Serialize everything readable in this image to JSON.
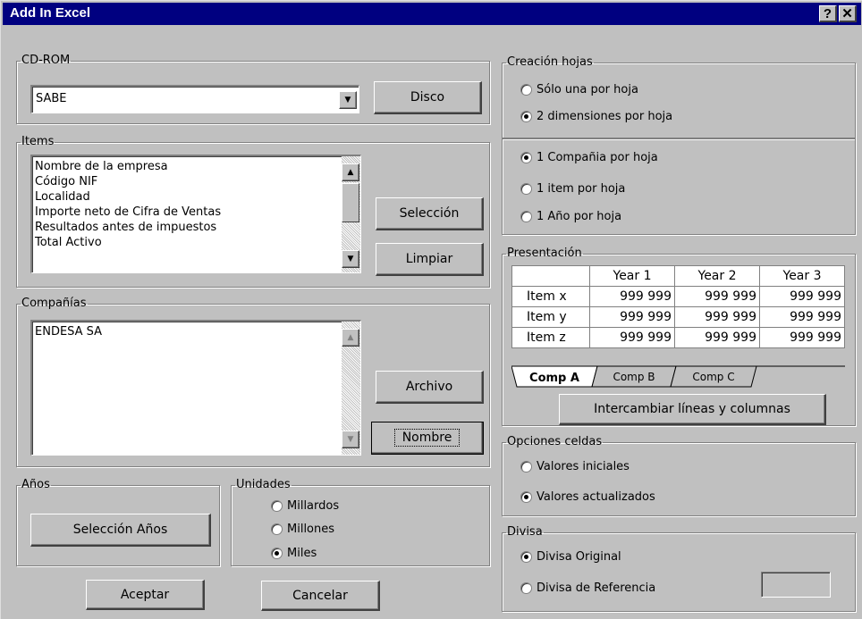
{
  "window": {
    "title": "Add In Excel",
    "help_glyph": "?",
    "close_glyph": "✕"
  },
  "cdrom": {
    "legend": "CD-ROM",
    "selected": "SABE",
    "disco_button": "Disco"
  },
  "items": {
    "legend": "Items",
    "list": [
      "Nombre de la empresa",
      "Código NIF",
      "Localidad",
      "Importe neto de Cifra de Ventas",
      "Resultados antes de impuestos",
      "Total Activo"
    ],
    "seleccion_button": "Selección",
    "limpiar_button": "Limpiar"
  },
  "companias": {
    "legend": "Compañías",
    "list": [
      "ENDESA SA"
    ],
    "archivo_button": "Archivo",
    "nombre_button": "Nombre"
  },
  "anios": {
    "legend": "Años",
    "button": "Selección Años"
  },
  "unidades": {
    "legend": "Unidades",
    "options": [
      {
        "label": "Millardos",
        "checked": false
      },
      {
        "label": "Millones",
        "checked": false
      },
      {
        "label": "Miles",
        "checked": true
      }
    ]
  },
  "footer": {
    "aceptar": "Aceptar",
    "cancelar": "Cancelar"
  },
  "creacion": {
    "legend": "Creación hojas",
    "options": [
      {
        "label": "Sólo una por hoja",
        "checked": false
      },
      {
        "label": "2 dimensiones por hoja",
        "checked": true
      }
    ],
    "options2": [
      {
        "label": "1 Compañia por hoja",
        "checked": true
      },
      {
        "label": "1 item por hoja",
        "checked": false
      },
      {
        "label": "1 Año por hoja",
        "checked": false
      }
    ]
  },
  "presentacion": {
    "legend": "Presentación",
    "columns": [
      "Year 1",
      "Year 2",
      "Year 3"
    ],
    "rows": [
      {
        "label": "Item x",
        "values": [
          "999 999",
          "999 999",
          "999 999"
        ]
      },
      {
        "label": "Item y",
        "values": [
          "999 999",
          "999 999",
          "999 999"
        ]
      },
      {
        "label": "Item z",
        "values": [
          "999 999",
          "999 999",
          "999 999"
        ]
      }
    ],
    "tabs": [
      "Comp A",
      "Comp B",
      "Comp C"
    ],
    "active_tab": "Comp A",
    "swap_button": "Intercambiar líneas y columnas"
  },
  "opciones": {
    "legend": "Opciones celdas",
    "options": [
      {
        "label": "Valores iniciales",
        "checked": false
      },
      {
        "label": "Valores actualizados",
        "checked": true
      }
    ]
  },
  "divisa": {
    "legend": "Divisa",
    "options": [
      {
        "label": "Divisa Original",
        "checked": true
      },
      {
        "label": "Divisa de Referencia",
        "checked": false
      }
    ]
  }
}
